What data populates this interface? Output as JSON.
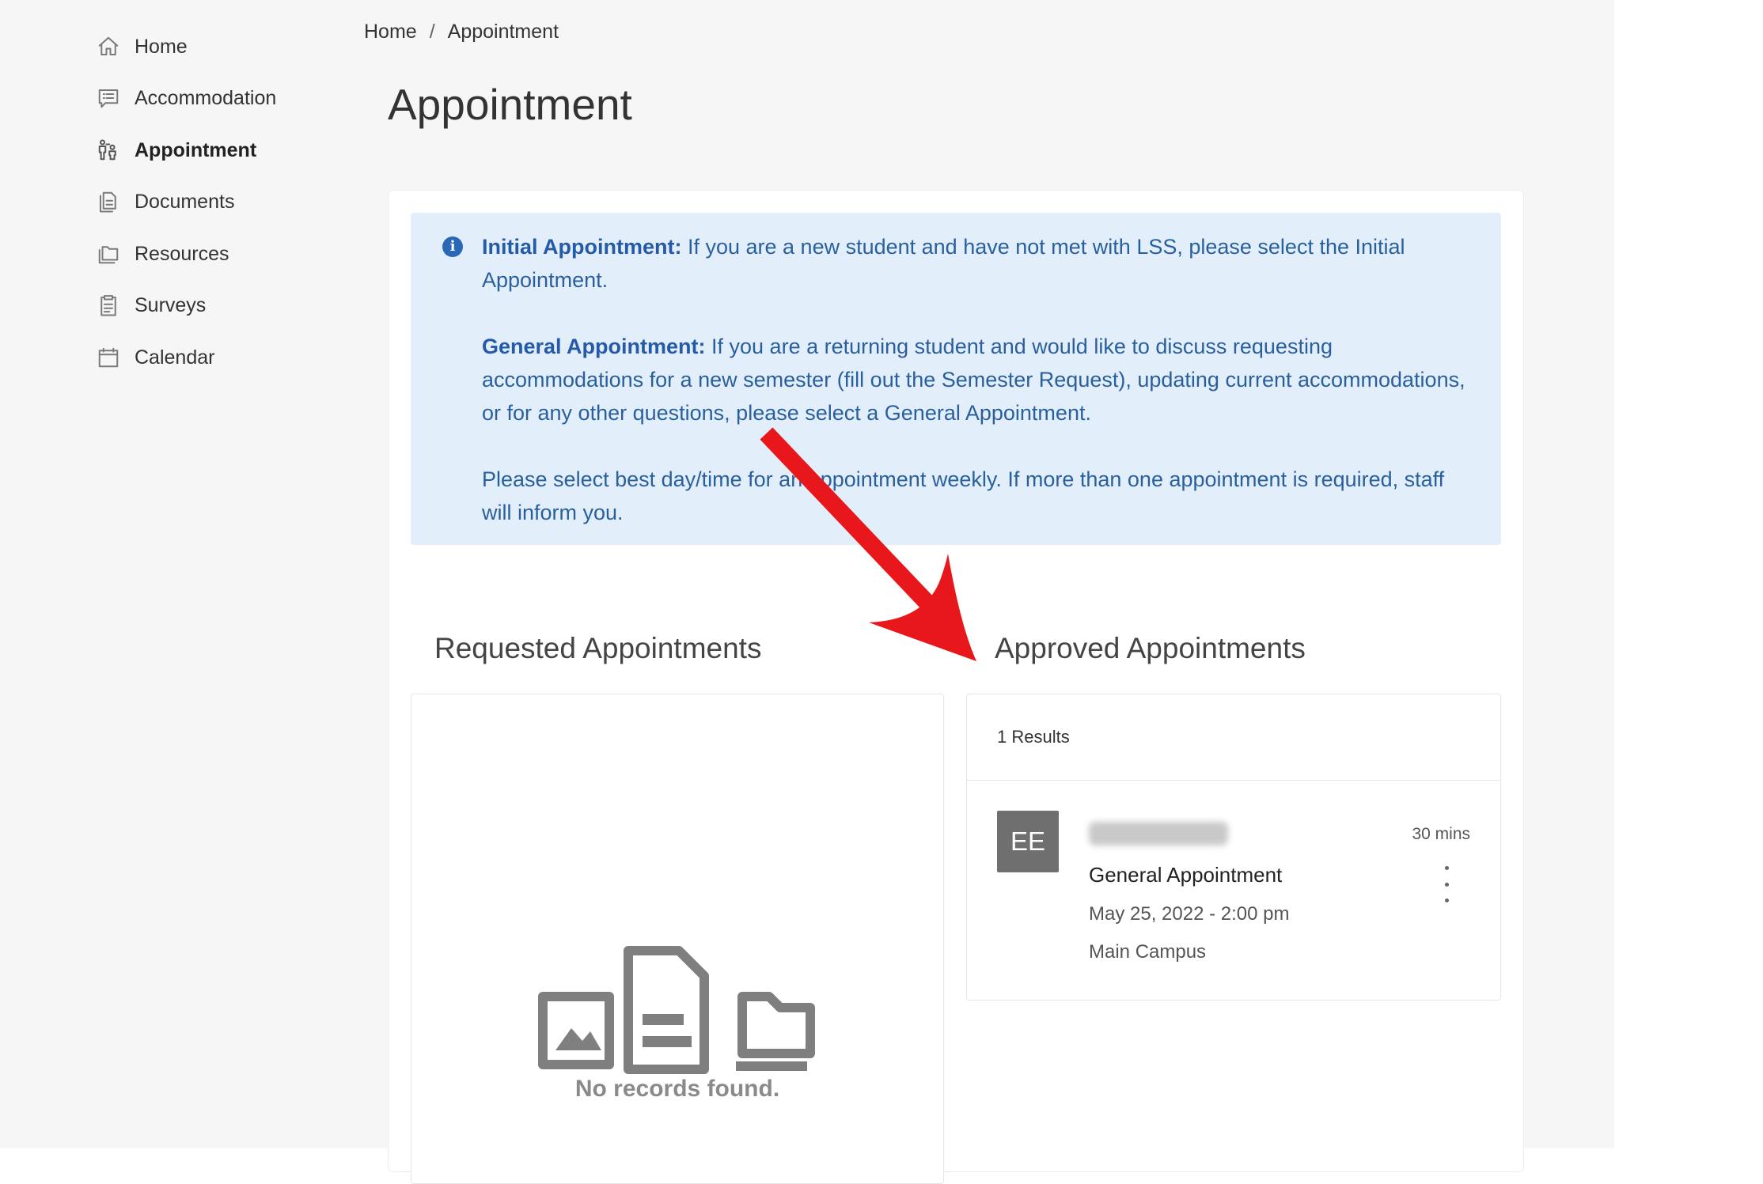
{
  "sidebar": {
    "items": [
      {
        "label": "Home",
        "icon": "home-icon"
      },
      {
        "label": "Accommodation",
        "icon": "list-icon"
      },
      {
        "label": "Appointment",
        "icon": "people-icon",
        "active": true
      },
      {
        "label": "Documents",
        "icon": "document-icon"
      },
      {
        "label": "Resources",
        "icon": "folder-icon"
      },
      {
        "label": "Surveys",
        "icon": "clipboard-icon"
      },
      {
        "label": "Calendar",
        "icon": "calendar-icon"
      }
    ]
  },
  "breadcrumb": {
    "home": "Home",
    "separator": "/",
    "current": "Appointment"
  },
  "page_title": "Appointment",
  "info": {
    "initial_title": "Initial Appointment:",
    "initial_text": " If you are a new student and have not met with LSS, please select the Initial Appointment.",
    "general_title": "General Appointment:",
    "general_text": " If you are a returning student and would like to discuss requesting accommodations for a new semester (fill out the Semester Request), updating current accommodations, or for any other questions, please select a General Appointment.",
    "weekly_text": "Please select best day/time for an appointment weekly. If more than one appointment is required, staff will inform you."
  },
  "requested": {
    "title": "Requested Appointments",
    "empty_text": "No records found."
  },
  "approved": {
    "title": "Approved Appointments",
    "results": "1 Results",
    "items": [
      {
        "avatar_initials": "EE",
        "duration": "30 mins",
        "type": "General Appointment",
        "date": "May 25, 2022 - 2:00 pm",
        "location": "Main Campus"
      }
    ]
  },
  "colors": {
    "info_bg": "#e2effb",
    "info_text": "#2a5f9e",
    "arrow": "#e8171c",
    "avatar_bg": "#6f6f6f"
  }
}
